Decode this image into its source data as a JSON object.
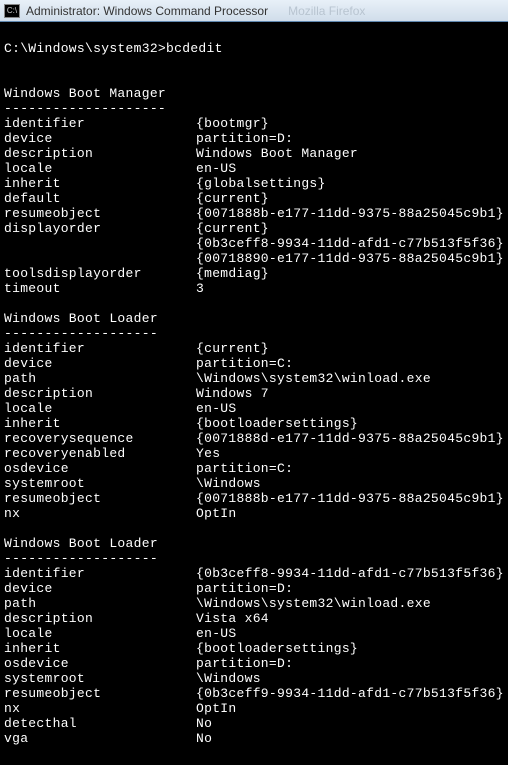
{
  "title_bar": {
    "icon_label": "C:\\",
    "title": "Administrator: Windows Command Processor",
    "ghost_text": "Mozilla Firefox"
  },
  "prompt": "C:\\Windows\\system32>bcdedit",
  "sections": [
    {
      "name": "Windows Boot Manager",
      "divider": "--------------------",
      "rows": [
        {
          "k": "identifier",
          "v": "{bootmgr}"
        },
        {
          "k": "device",
          "v": "partition=D:"
        },
        {
          "k": "description",
          "v": "Windows Boot Manager"
        },
        {
          "k": "locale",
          "v": "en-US"
        },
        {
          "k": "inherit",
          "v": "{globalsettings}"
        },
        {
          "k": "default",
          "v": "{current}"
        },
        {
          "k": "resumeobject",
          "v": "{0071888b-e177-11dd-9375-88a25045c9b1}"
        },
        {
          "k": "displayorder",
          "v": "{current}"
        },
        {
          "k": "",
          "v": "{0b3ceff8-9934-11dd-afd1-c77b513f5f36}"
        },
        {
          "k": "",
          "v": "{00718890-e177-11dd-9375-88a25045c9b1}"
        },
        {
          "k": "toolsdisplayorder",
          "v": "{memdiag}"
        },
        {
          "k": "timeout",
          "v": "3"
        }
      ]
    },
    {
      "name": "Windows Boot Loader",
      "divider": "-------------------",
      "rows": [
        {
          "k": "identifier",
          "v": "{current}"
        },
        {
          "k": "device",
          "v": "partition=C:"
        },
        {
          "k": "path",
          "v": "\\Windows\\system32\\winload.exe"
        },
        {
          "k": "description",
          "v": "Windows 7"
        },
        {
          "k": "locale",
          "v": "en-US"
        },
        {
          "k": "inherit",
          "v": "{bootloadersettings}"
        },
        {
          "k": "recoverysequence",
          "v": "{0071888d-e177-11dd-9375-88a25045c9b1}"
        },
        {
          "k": "recoveryenabled",
          "v": "Yes"
        },
        {
          "k": "osdevice",
          "v": "partition=C:"
        },
        {
          "k": "systemroot",
          "v": "\\Windows"
        },
        {
          "k": "resumeobject",
          "v": "{0071888b-e177-11dd-9375-88a25045c9b1}"
        },
        {
          "k": "nx",
          "v": "OptIn"
        }
      ]
    },
    {
      "name": "Windows Boot Loader",
      "divider": "-------------------",
      "rows": [
        {
          "k": "identifier",
          "v": "{0b3ceff8-9934-11dd-afd1-c77b513f5f36}"
        },
        {
          "k": "device",
          "v": "partition=D:"
        },
        {
          "k": "path",
          "v": "\\Windows\\system32\\winload.exe"
        },
        {
          "k": "description",
          "v": "Vista x64"
        },
        {
          "k": "locale",
          "v": "en-US"
        },
        {
          "k": "inherit",
          "v": "{bootloadersettings}"
        },
        {
          "k": "osdevice",
          "v": "partition=D:"
        },
        {
          "k": "systemroot",
          "v": "\\Windows"
        },
        {
          "k": "resumeobject",
          "v": "{0b3ceff9-9934-11dd-afd1-c77b513f5f36}"
        },
        {
          "k": "nx",
          "v": "OptIn"
        },
        {
          "k": "detecthal",
          "v": "No"
        },
        {
          "k": "vga",
          "v": "No"
        }
      ]
    }
  ]
}
